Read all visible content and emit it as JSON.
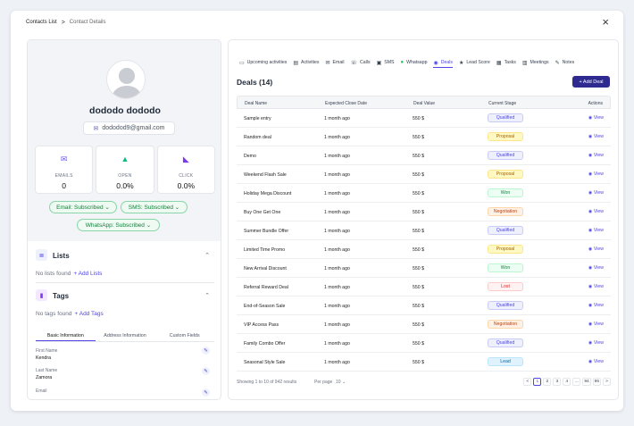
{
  "breadcrumb": {
    "root": "Contacts List",
    "separator": ">",
    "current": "Contact Details"
  },
  "close_label": "×",
  "profile": {
    "name": "dododo dododo",
    "email": "dododod9@gmail.com",
    "stats": [
      {
        "label": "EMAILS",
        "value": "0",
        "icon": "envelope-icon",
        "color": "#6d5ce7"
      },
      {
        "label": "OPEN",
        "value": "0.0%",
        "icon": "open-envelope-icon",
        "color": "#10b981"
      },
      {
        "label": "CLICK",
        "value": "0.0%",
        "icon": "cursor-click-icon",
        "color": "#7c3aed"
      }
    ],
    "subscriptions": [
      {
        "label": "Email: Subscribed"
      },
      {
        "label": "SMS: Subscribed"
      },
      {
        "label": "WhatsApp: Subscribed"
      }
    ]
  },
  "lists": {
    "title": "Lists",
    "empty": "No lists found",
    "add": "+ Add Lists"
  },
  "tags": {
    "title": "Tags",
    "empty": "No tags found",
    "add": "+ Add Tags"
  },
  "info_tabs": [
    "Basic Information",
    "Address Information",
    "Custom Fields"
  ],
  "fields": [
    {
      "label": "First Name",
      "value": "Kendra"
    },
    {
      "label": "Last Name",
      "value": "Zamora"
    },
    {
      "label": "Email",
      "value": ""
    }
  ],
  "nav_tabs": [
    {
      "label": "Upcoming activities",
      "icon": "calendar-upcoming-icon"
    },
    {
      "label": "Activities",
      "icon": "activity-icon"
    },
    {
      "label": "Email",
      "icon": "email-icon"
    },
    {
      "label": "Calls",
      "icon": "phone-icon"
    },
    {
      "label": "SMS",
      "icon": "sms-icon"
    },
    {
      "label": "Whatsapp",
      "icon": "whatsapp-icon"
    },
    {
      "label": "Deals",
      "icon": "deals-icon",
      "active": true
    },
    {
      "label": "Lead Score",
      "icon": "star-icon"
    },
    {
      "label": "Tasks",
      "icon": "tasks-icon"
    },
    {
      "label": "Meetings",
      "icon": "meetings-icon"
    },
    {
      "label": "Notes",
      "icon": "notes-icon"
    }
  ],
  "deals": {
    "title": "Deals (14)",
    "add_button": "+ Add Deal",
    "columns": [
      "Deal Name",
      "Expected Close Date",
      "Deal Value",
      "Current Stage",
      "Actions"
    ],
    "rows": [
      {
        "name": "Sample entry",
        "date": "1 month ago",
        "value": "550 $",
        "stage": "Qualified"
      },
      {
        "name": "Random deal",
        "date": "1 month ago",
        "value": "550 $",
        "stage": "Proposal"
      },
      {
        "name": "Demo",
        "date": "1 month ago",
        "value": "550 $",
        "stage": "Qualified"
      },
      {
        "name": "Weekend Flash Sale",
        "date": "1 month ago",
        "value": "550 $",
        "stage": "Proposal"
      },
      {
        "name": "Holiday Mega Discount",
        "date": "1 month ago",
        "value": "550 $",
        "stage": "Won"
      },
      {
        "name": "Buy One Get One",
        "date": "1 month ago",
        "value": "550 $",
        "stage": "Negotiation"
      },
      {
        "name": "Summer Bundle Offer",
        "date": "1 month ago",
        "value": "550 $",
        "stage": "Qualified"
      },
      {
        "name": "Limited Time Promo",
        "date": "1 month ago",
        "value": "550 $",
        "stage": "Proposal"
      },
      {
        "name": "New Arrival Discount",
        "date": "1 month ago",
        "value": "550 $",
        "stage": "Won"
      },
      {
        "name": "Referral Reward Deal",
        "date": "1 month ago",
        "value": "550 $",
        "stage": "Lost"
      },
      {
        "name": "End-of-Season Sale",
        "date": "1 month ago",
        "value": "550 $",
        "stage": "Qualified"
      },
      {
        "name": "VIP Access Pass",
        "date": "1 month ago",
        "value": "550 $",
        "stage": "Negotiation"
      },
      {
        "name": "Family Combo Offer",
        "date": "1 month ago",
        "value": "550 $",
        "stage": "Qualified"
      },
      {
        "name": "Seasonal Style Sale",
        "date": "1 month ago",
        "value": "550 $",
        "stage": "Lead"
      }
    ],
    "view_label": "View",
    "footer": {
      "showing": "Showing 1 to 10 of 942 results",
      "per_page_label": "Per page",
      "per_page_value": "10",
      "pages": [
        "<",
        "1",
        "2",
        "3",
        "4",
        "...",
        "94",
        "95",
        ">"
      ],
      "active_page": "1"
    }
  },
  "stage_colors": {
    "Qualified": {
      "bg": "#eef0fd",
      "fg": "#4f46e5",
      "border": "#c7cbf5"
    },
    "Proposal": {
      "bg": "#fef9c3",
      "fg": "#a16207",
      "border": "#fde68a"
    },
    "Won": {
      "bg": "#ecfdf3",
      "fg": "#15803d",
      "border": "#bbf7d0"
    },
    "Negotiation": {
      "bg": "#fff1e6",
      "fg": "#c2410c",
      "border": "#fed7aa"
    },
    "Lost": {
      "bg": "#fef2f2",
      "fg": "#dc2626",
      "border": "#fecaca"
    },
    "Lead": {
      "bg": "#e0f2fe",
      "fg": "#0369a1",
      "border": "#bae6fd"
    }
  }
}
